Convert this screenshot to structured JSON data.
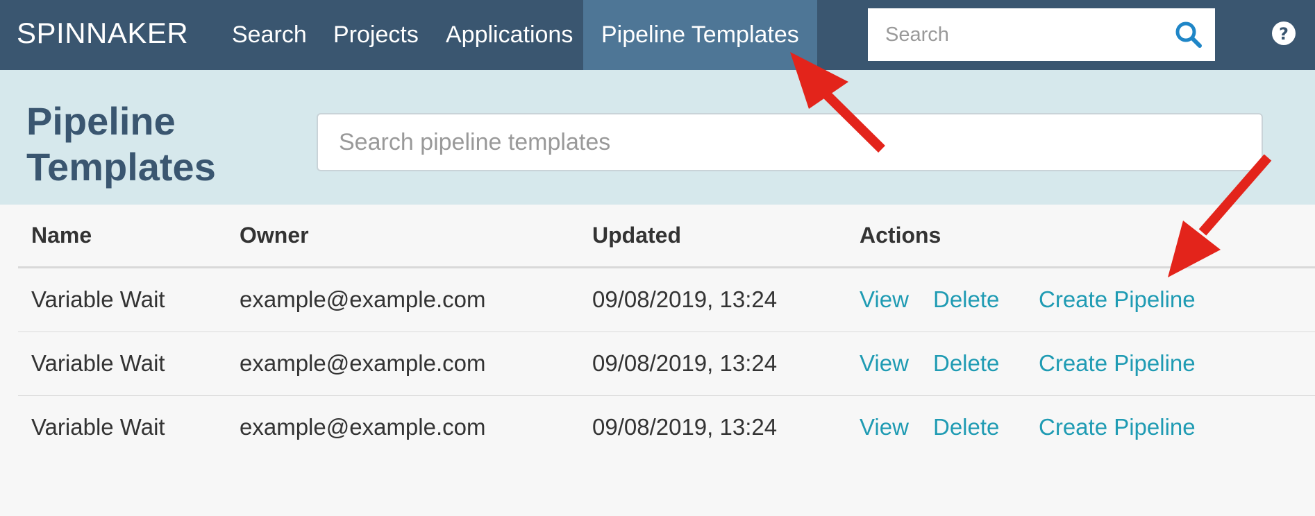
{
  "nav": {
    "brand": "SPINNAKER",
    "items": [
      {
        "label": "Search"
      },
      {
        "label": "Projects"
      },
      {
        "label": "Applications"
      },
      {
        "label": "Pipeline Templates",
        "active": true
      }
    ],
    "search_placeholder": "Search"
  },
  "header": {
    "title": "Pipeline Templates",
    "filter_placeholder": "Search pipeline templates"
  },
  "table": {
    "columns": [
      "Name",
      "Owner",
      "Updated",
      "Actions"
    ],
    "rows": [
      {
        "name": "Variable Wait",
        "owner": "example@example.com",
        "updated": "09/08/2019, 13:24",
        "actions": [
          "View",
          "Delete",
          "Create Pipeline"
        ]
      },
      {
        "name": "Variable Wait",
        "owner": "example@example.com",
        "updated": "09/08/2019, 13:24",
        "actions": [
          "View",
          "Delete",
          "Create Pipeline"
        ]
      },
      {
        "name": "Variable Wait",
        "owner": "example@example.com",
        "updated": "09/08/2019, 13:24",
        "actions": [
          "View",
          "Delete",
          "Create Pipeline"
        ]
      }
    ]
  },
  "colors": {
    "nav_bg": "#3a5670",
    "nav_active": "#4e7696",
    "header_bg": "#d6e8ec",
    "link": "#1f9bb3",
    "annotation_arrow": "#e3241b"
  },
  "annotations": [
    "red-arrow-icon",
    "red-arrow-icon"
  ]
}
